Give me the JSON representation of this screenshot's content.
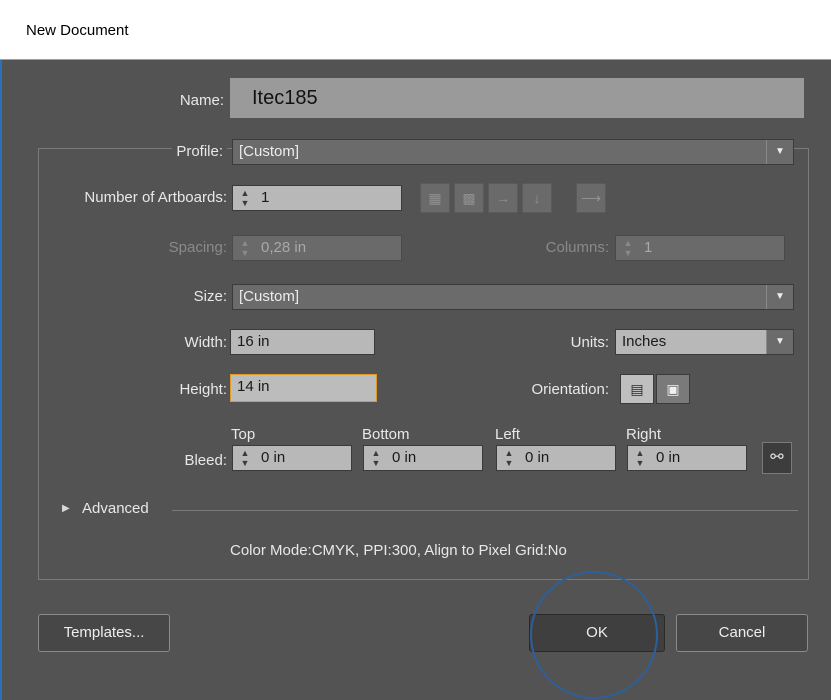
{
  "window": {
    "title": "New Document"
  },
  "labels": {
    "name": "Name:",
    "profile": "Profile:",
    "artboards": "Number of Artboards:",
    "spacing": "Spacing:",
    "columns": "Columns:",
    "size": "Size:",
    "width": "Width:",
    "units": "Units:",
    "height": "Height:",
    "orientation": "Orientation:",
    "bleed": "Bleed:",
    "bleed_top": "Top",
    "bleed_bottom": "Bottom",
    "bleed_left": "Left",
    "bleed_right": "Right",
    "advanced": "Advanced"
  },
  "values": {
    "name": "Itec185",
    "profile": "[Custom]",
    "artboards": "1",
    "spacing": "0,28 in",
    "columns": "1",
    "size": "[Custom]",
    "width": "16 in",
    "units": "Inches",
    "height": "14 in",
    "bleed_top": "0 in",
    "bleed_bottom": "0 in",
    "bleed_left": "0 in",
    "bleed_right": "0 in"
  },
  "info": "Color Mode:CMYK, PPI:300, Align to Pixel Grid:No",
  "buttons": {
    "templates": "Templates...",
    "ok": "OK",
    "cancel": "Cancel"
  },
  "icons": {
    "spinner": "up-down-spinner-icon",
    "arrange": [
      "grid-by-row-icon",
      "grid-by-column-icon",
      "arrange-by-row-icon",
      "arrange-by-column-icon",
      "right-to-left-icon"
    ],
    "orientation": [
      "portrait-icon",
      "landscape-icon"
    ],
    "link": "link-icon"
  },
  "colors": {
    "panel": "#535353",
    "focus_border": "#e09a2a",
    "annotation_circle": "#2d5f9a"
  }
}
